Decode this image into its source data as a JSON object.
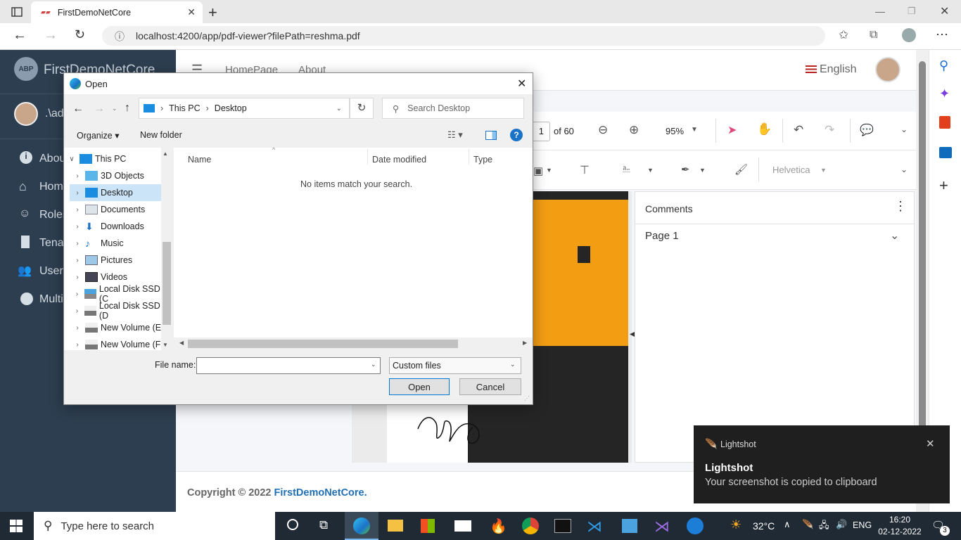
{
  "browser": {
    "tab_title": "FirstDemoNetCore",
    "url": "localhost:4200/app/pdf-viewer?filePath=reshma.pdf",
    "new_tab_label": "+"
  },
  "app": {
    "brand": "FirstDemoNetCore",
    "logo_text": "ABP",
    "user": ".\\ad",
    "nav": [
      {
        "label": "Abou",
        "icon": "info-icon"
      },
      {
        "label": "Hom",
        "icon": "home-icon"
      },
      {
        "label": "Roles",
        "icon": "theater-masks-icon"
      },
      {
        "label": "Tena",
        "icon": "building-icon"
      },
      {
        "label": "Users",
        "icon": "users-icon"
      },
      {
        "label": "Multi",
        "icon": "circle-icon"
      }
    ],
    "header_links": [
      "HomePage",
      "About"
    ],
    "language": "English",
    "footer_prefix": "Copyright © 2022 ",
    "footer_brand": "FirstDemoNetCore."
  },
  "pdf": {
    "page_total": "of 60",
    "page_input": "1",
    "zoom": "95%",
    "font": "Helvetica",
    "comments_title": "Comments",
    "comments_page": "Page 1"
  },
  "dialog": {
    "title": "Open",
    "breadcrumb": [
      "This PC",
      "Desktop"
    ],
    "search_placeholder": "Search Desktop",
    "organize": "Organize",
    "new_folder": "New folder",
    "columns": [
      "Name",
      "Date modified",
      "Type"
    ],
    "empty_message": "No items match your search.",
    "tree": [
      {
        "label": "This PC",
        "expanded": true,
        "indent": 0
      },
      {
        "label": "3D Objects",
        "indent": 1
      },
      {
        "label": "Desktop",
        "indent": 1,
        "selected": true
      },
      {
        "label": "Documents",
        "indent": 1
      },
      {
        "label": "Downloads",
        "indent": 1
      },
      {
        "label": "Music",
        "indent": 1
      },
      {
        "label": "Pictures",
        "indent": 1
      },
      {
        "label": "Videos",
        "indent": 1
      },
      {
        "label": "Local Disk SSD (C",
        "indent": 1
      },
      {
        "label": "Local Disk SSD (D",
        "indent": 1
      },
      {
        "label": "New Volume (E:)",
        "indent": 1
      },
      {
        "label": "New Volume (F:)",
        "indent": 1
      }
    ],
    "file_name_label": "File name:",
    "file_name_value": "",
    "file_type": "Custom files",
    "open_button": "Open",
    "cancel_button": "Cancel"
  },
  "toast": {
    "app": "Lightshot",
    "title": "Lightshot",
    "message": "Your screenshot is copied to clipboard"
  },
  "taskbar": {
    "search_placeholder": "Type here to search",
    "temperature": "32°C",
    "language": "ENG",
    "time": "16:20",
    "date": "02-12-2022",
    "notifications": "3"
  }
}
